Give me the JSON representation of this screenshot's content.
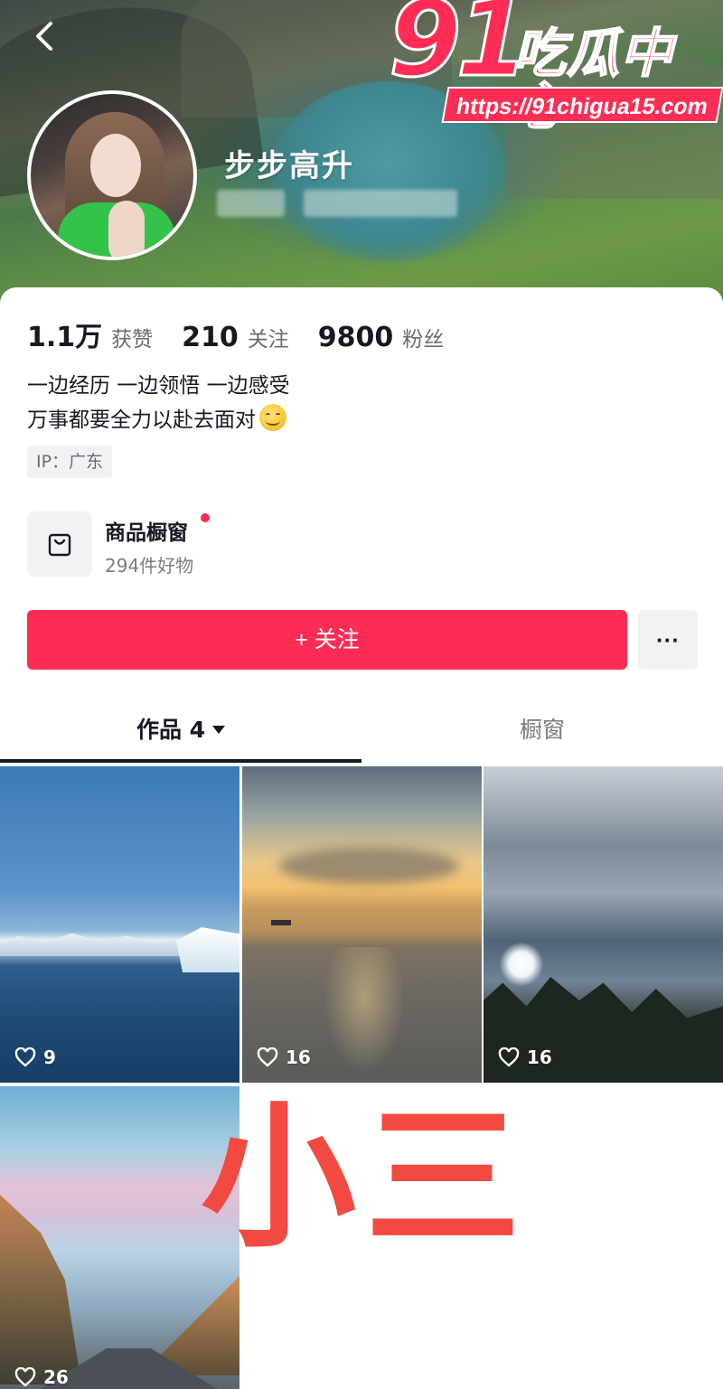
{
  "header": {
    "nickname": "步步高升",
    "watermark": {
      "number": "91",
      "brand": "吃瓜中心",
      "url": "https://91chigua15.com"
    }
  },
  "stats": [
    {
      "value": "1.1万",
      "label": "获赞"
    },
    {
      "value": "210",
      "label": "关注"
    },
    {
      "value": "9800",
      "label": "粉丝"
    }
  ],
  "bio": {
    "line1": "一边经历 一边领悟 一边感受",
    "line2": "万事都要全力以赴去面对"
  },
  "ip": "IP：广东",
  "shop": {
    "title": "商品橱窗",
    "subtitle": "294件好物"
  },
  "actions": {
    "follow": "+ 关注",
    "more": "···"
  },
  "tabs": {
    "works": "作品 4",
    "shop": "橱窗"
  },
  "posts": [
    {
      "likes": "9"
    },
    {
      "likes": "16"
    },
    {
      "likes": "16"
    },
    {
      "likes": "26"
    }
  ],
  "overlay_text": "小三",
  "colors": {
    "accent": "#fe2c55",
    "stamp": "#f24a42"
  }
}
